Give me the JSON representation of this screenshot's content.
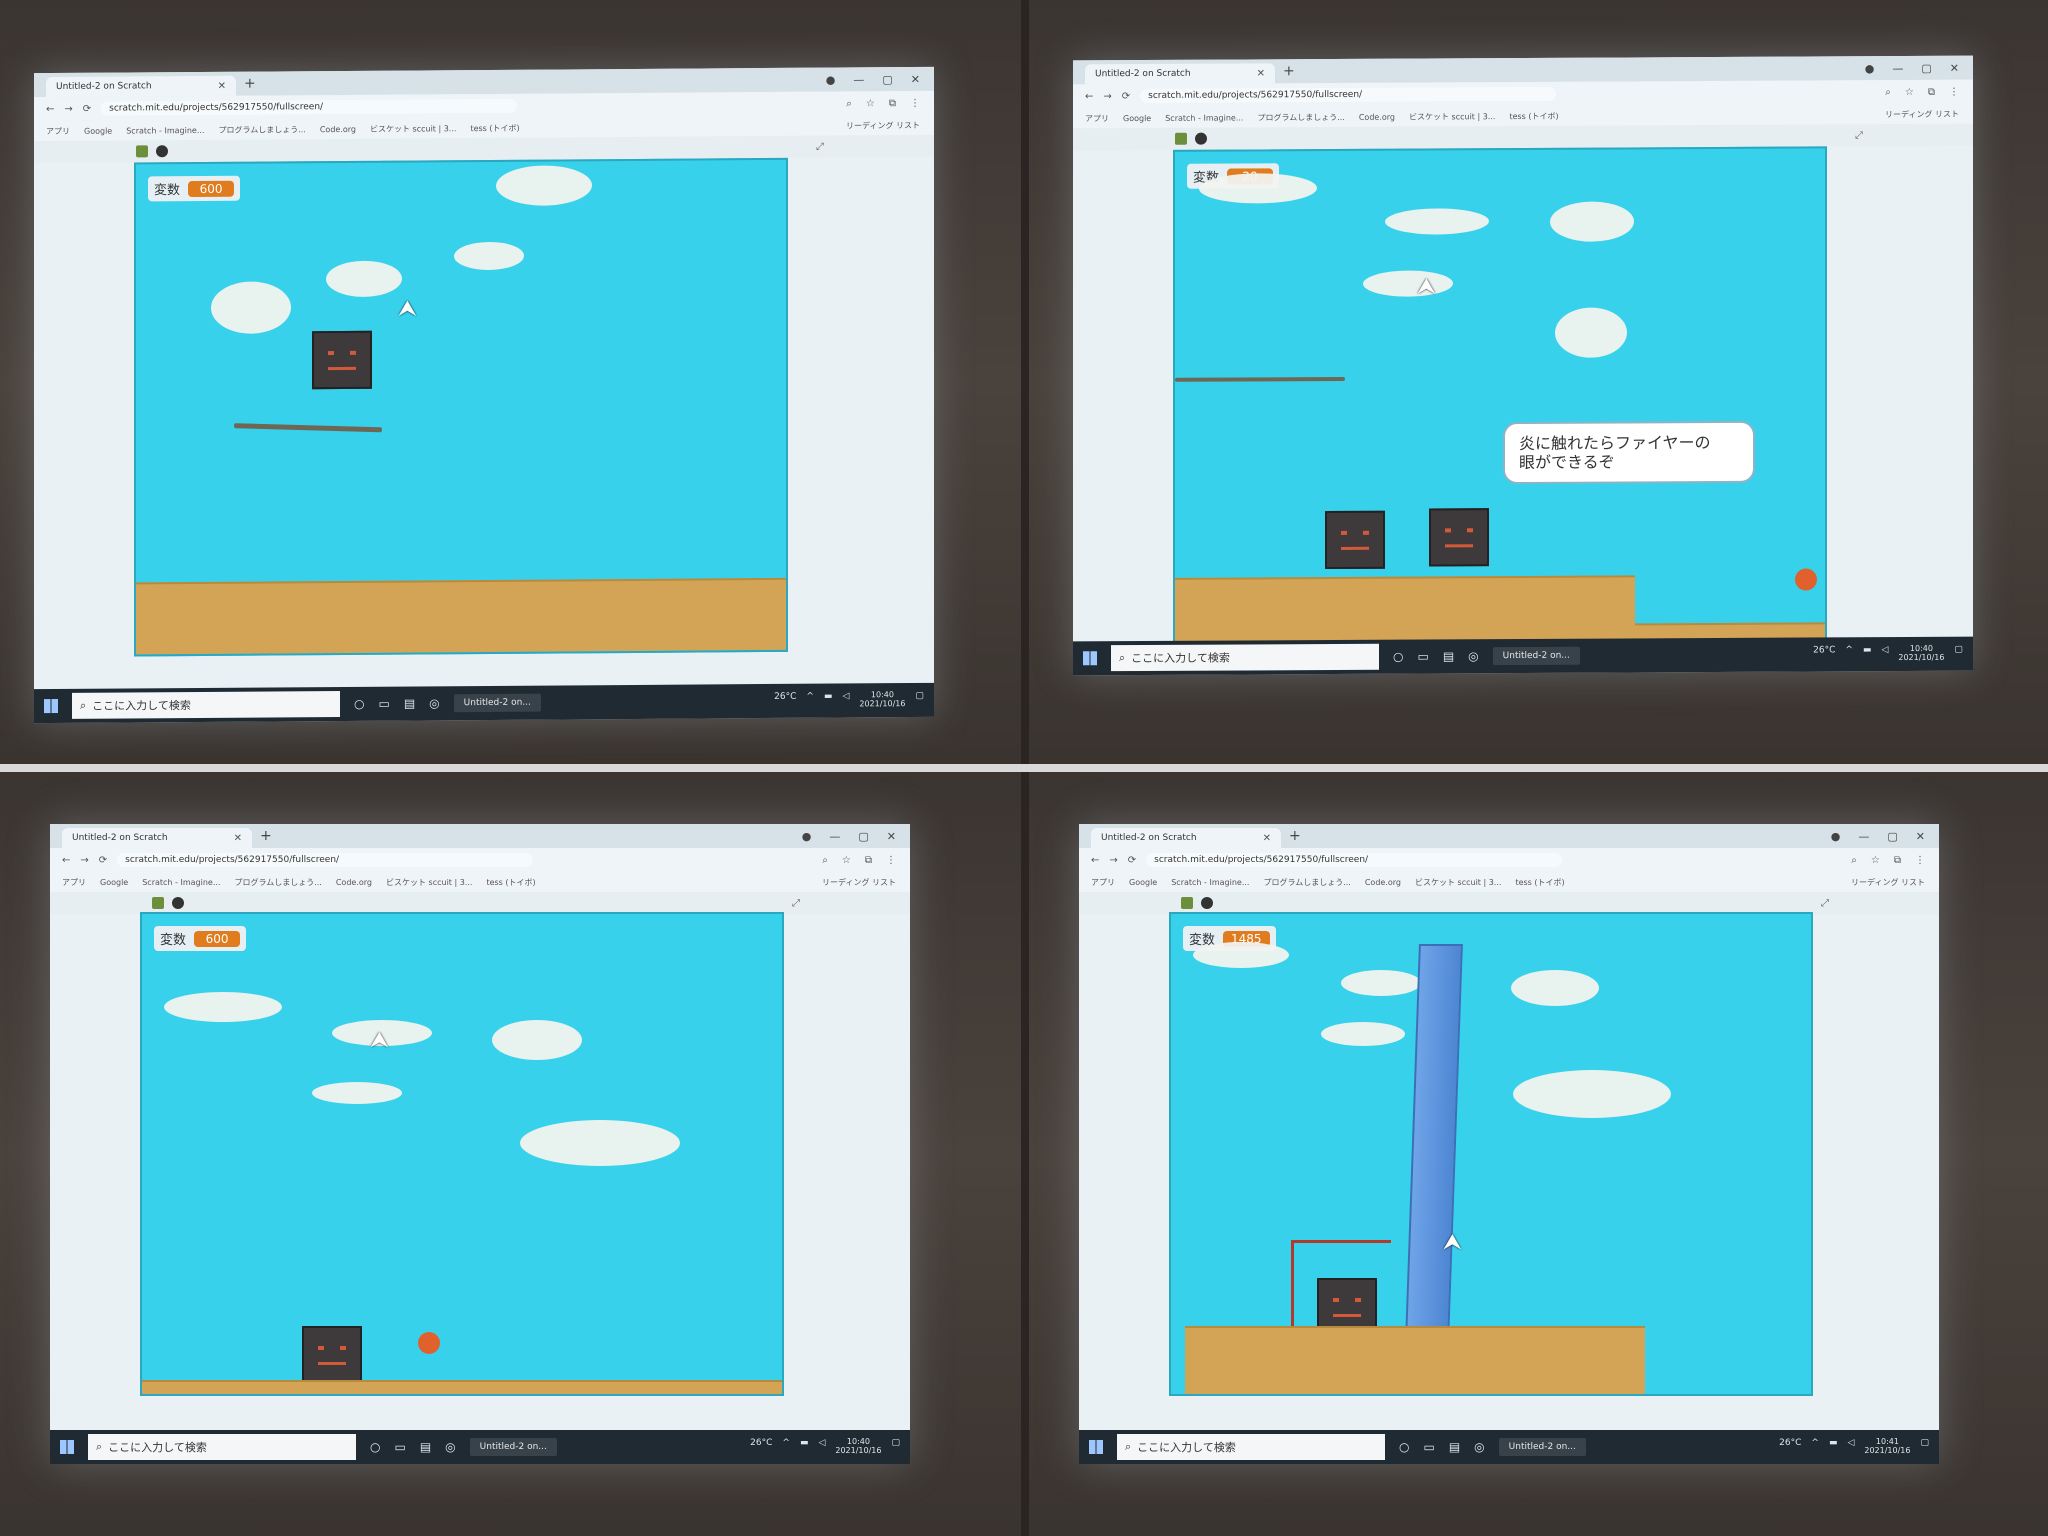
{
  "panels": [
    {
      "tab_title": "Untitled-2 on Scratch",
      "url": "scratch.mit.edu/projects/562917550/fullscreen/",
      "bookmarks": [
        "アプリ",
        "Google",
        "Scratch - Imagine...",
        "プログラムしましょう...",
        "Code.org",
        "ビスケット sccuit | 3...",
        "tess (トイボ)"
      ],
      "reading_list": "リーディング リスト",
      "var_label": "変数",
      "var_value": "600",
      "taskbar_search": "ここに入力して検索",
      "taskbar_app": "Untitled-2 on...",
      "weather": "26°C",
      "time": "10:40",
      "date": "2021/10/16"
    },
    {
      "tab_title": "Untitled-2 on Scratch",
      "url": "scratch.mit.edu/projects/562917550/fullscreen/",
      "bookmarks": [
        "アプリ",
        "Google",
        "Scratch - Imagine...",
        "プログラムしましょう...",
        "Code.org",
        "ビスケット sccuit | 3...",
        "tess (トイボ)"
      ],
      "reading_list": "リーディング リスト",
      "var_label": "変数",
      "var_value": "20",
      "speech": "炎に触れたらファイヤーの\n眼ができるぞ",
      "taskbar_search": "ここに入力して検索",
      "taskbar_app": "Untitled-2 on...",
      "weather": "26°C",
      "time": "10:40",
      "date": "2021/10/16"
    },
    {
      "tab_title": "Untitled-2 on Scratch",
      "url": "scratch.mit.edu/projects/562917550/fullscreen/",
      "bookmarks": [
        "アプリ",
        "Google",
        "Scratch - Imagine...",
        "プログラムしましょう...",
        "Code.org",
        "ビスケット sccuit | 3...",
        "tess (トイボ)"
      ],
      "reading_list": "リーディング リスト",
      "var_label": "変数",
      "var_value": "600",
      "taskbar_search": "ここに入力して検索",
      "taskbar_app": "Untitled-2 on...",
      "weather": "26°C",
      "time": "10:40",
      "date": "2021/10/16"
    },
    {
      "tab_title": "Untitled-2 on Scratch",
      "url": "scratch.mit.edu/projects/562917550/fullscreen/",
      "bookmarks": [
        "アプリ",
        "Google",
        "Scratch - Imagine...",
        "プログラムしましょう...",
        "Code.org",
        "ビスケット sccuit | 3...",
        "tess (トイボ)"
      ],
      "reading_list": "リーディング リスト",
      "var_label": "変数",
      "var_value": "1485",
      "taskbar_search": "ここに入力して検索",
      "taskbar_app": "Untitled-2 on...",
      "weather": "26°C",
      "time": "10:41",
      "date": "2021/10/16"
    }
  ],
  "icons": {
    "back": "arrow-left-icon",
    "forward": "arrow-right-icon",
    "reload": "reload-icon",
    "lock": "lock-icon",
    "flag": "green-flag-icon",
    "stop": "stop-icon",
    "fullscreen": "fullscreen-icon",
    "windows": "windows-start-icon",
    "search": "search-icon",
    "cursor": "mouse-cursor-icon"
  },
  "colors": {
    "sky": "#38d1ec",
    "ground": "#d4a456",
    "var_badge": "#e07b1e",
    "taskbar": "#1f2a33"
  }
}
